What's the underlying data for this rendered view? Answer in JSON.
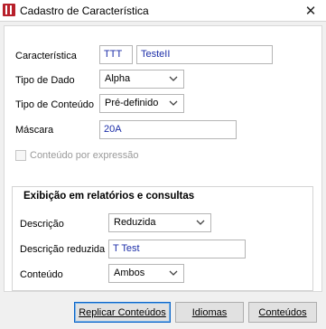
{
  "window": {
    "title": "Cadastro de Característica",
    "close_glyph": "✕",
    "app_icon": "app-logo-icon"
  },
  "form": {
    "caracteristica": {
      "label": "Característica",
      "code": "TTT",
      "name": "TesteII"
    },
    "tipo_dado": {
      "label": "Tipo de Dado",
      "value": "Alpha"
    },
    "tipo_conteudo": {
      "label": "Tipo de Conteúdo",
      "value": "Pré-definido"
    },
    "mascara": {
      "label": "Máscara",
      "value": "20A"
    },
    "conteudo_expressao": {
      "label": "Conteúdo por expressão",
      "checked": false
    }
  },
  "exibicao": {
    "title": "Exibição em relatórios e consultas",
    "descricao": {
      "label": "Descrição",
      "value": "Reduzida"
    },
    "descricao_reduzida": {
      "label": "Descrição reduzida",
      "value": "T Test"
    },
    "conteudo": {
      "label": "Conteúdo",
      "value": "Ambos"
    }
  },
  "buttons": {
    "replicar": "Replicar Conteúdos",
    "idiomas": "Idiomas",
    "conteudos": "Conteúdos"
  },
  "colors": {
    "input_text": "#1c2ea8",
    "default_button_border": "#0a64c8",
    "icon": "#b8202b"
  }
}
